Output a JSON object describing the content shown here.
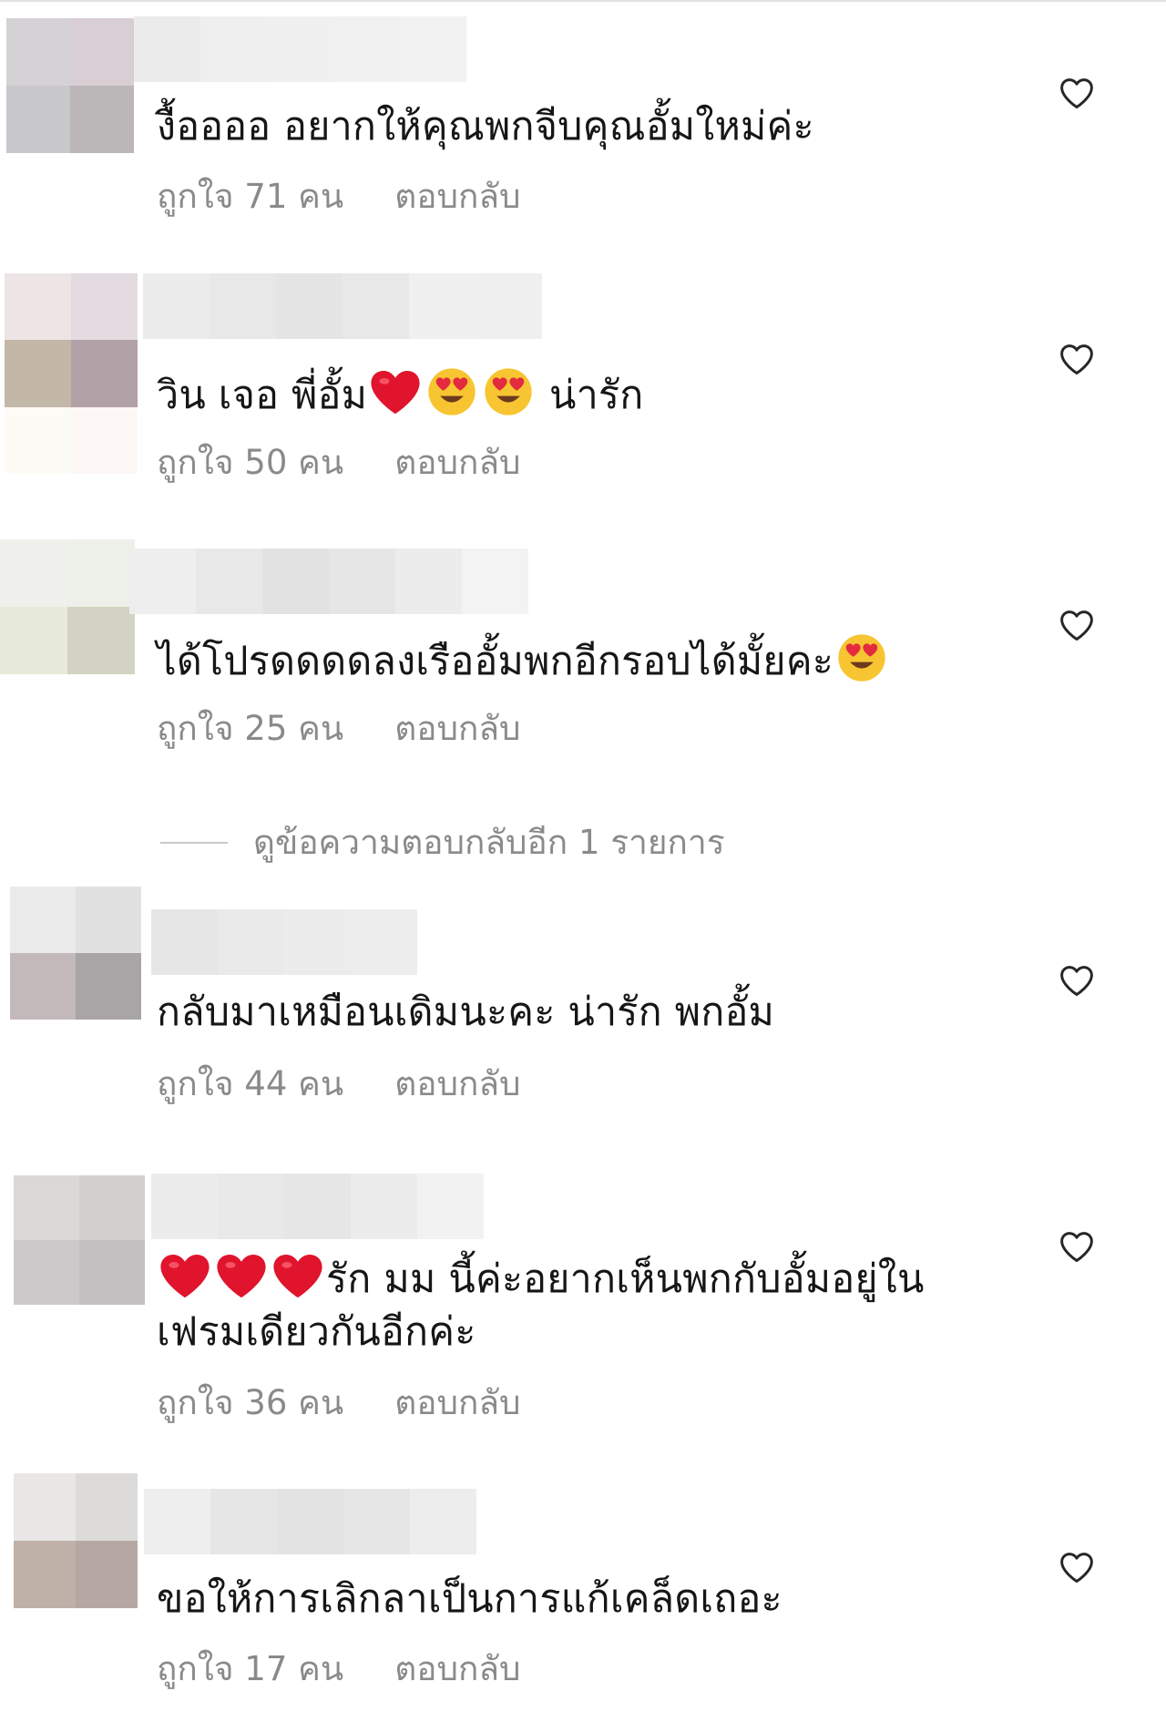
{
  "comments": [
    {
      "text": "งื้ออออ อยากให้คุณพกจีบคุณอั้มใหม่ค่ะ",
      "likes": "ถูกใจ 71 คน",
      "reply": "ตอบกลับ",
      "avatar_colors": [
        "#d4d2d5",
        "#d8ced3",
        "#c8c7ca",
        "#bbb7b8"
      ],
      "username_colors": [
        "#ebebeb",
        "#efefef",
        "#f0f0f0",
        "#f1f1f1",
        "#f2f2f2"
      ]
    },
    {
      "text_before": "วิน เจอ พี่อั้ม",
      "text_after": " น่ารัก",
      "emojis": [
        "red-heart",
        "heart-eyes",
        "heart-eyes"
      ],
      "likes": "ถูกใจ 50 คน",
      "reply": "ตอบกลับ",
      "avatar_colors": [
        "#ede4e6",
        "#e4dbe0",
        "#c3b7a8",
        "#b2a1a6"
      ],
      "username_colors": [
        "#ececec",
        "#e8e8e8",
        "#e5e5e5",
        "#e8e8e8",
        "#f0f0f0",
        "#efefef"
      ]
    },
    {
      "text_before": "ได้โปรดดดดลงเรืออั้มพกอีกรอบได้มั้ยคะ",
      "emojis": [
        "heart-eyes"
      ],
      "likes": "ถูกใจ 25 คน",
      "reply": "ตอบกลับ",
      "avatar_colors": [
        "#f0f1ed",
        "#eef0ea",
        "#e7ead9",
        "#d2d3c2"
      ],
      "username_colors": [
        "#eeeeee",
        "#e8e8e8",
        "#e2e2e2",
        "#e6e6e6",
        "#ececec",
        "#f3f3f3"
      ]
    },
    {
      "text": "กลับมาเหมือนเดิมนะคะ น่ารัก พกอั้ม",
      "likes": "ถูกใจ 44 คน",
      "reply": "ตอบกลับ",
      "avatar_colors": [
        "#ebebeb",
        "#e1e1e1",
        "#c4b9ba",
        "#a9a4a6"
      ],
      "username_colors": [
        "#e6e6e6",
        "#eaeaea",
        "#ececec",
        "#ededed"
      ]
    },
    {
      "emojis": [
        "red-heart",
        "red-heart",
        "red-heart"
      ],
      "text_after": "รัก มม นี้ค่ะอยากเห็นพกกับอั้มอยู่ใน",
      "text_line2": "เฟรมเดียวกันอีกค่ะ",
      "likes": "ถูกใจ 36 คน",
      "reply": "ตอบกลับ",
      "avatar_colors": [
        "#dcd8d5",
        "#d2cfcd",
        "#cdc9cb",
        "#c4c0c1"
      ],
      "username_colors": [
        "#ececec",
        "#e9e9e9",
        "#e6e6e6",
        "#ececec",
        "#f2f2f2"
      ]
    },
    {
      "text": "ขอให้การเลิกลาเป็นการแก้เคล็ดเถอะ",
      "likes": "ถูกใจ 17 คน",
      "reply": "ตอบกลับ",
      "avatar_colors": [
        "#e8e7e6",
        "#dcdbda",
        "#bfb0a8",
        "#b5a8a2"
      ],
      "username_colors": [
        "#eeeeee",
        "#e6e6e6",
        "#e3e3e3",
        "#e6e6e6",
        "#ededed"
      ]
    }
  ],
  "view_replies": "ดูข้อความตอบกลับอีก 1 รายการ",
  "colors": {
    "text": "#161616",
    "meta": "#8a8a8a",
    "heart_outline": "#262626"
  }
}
